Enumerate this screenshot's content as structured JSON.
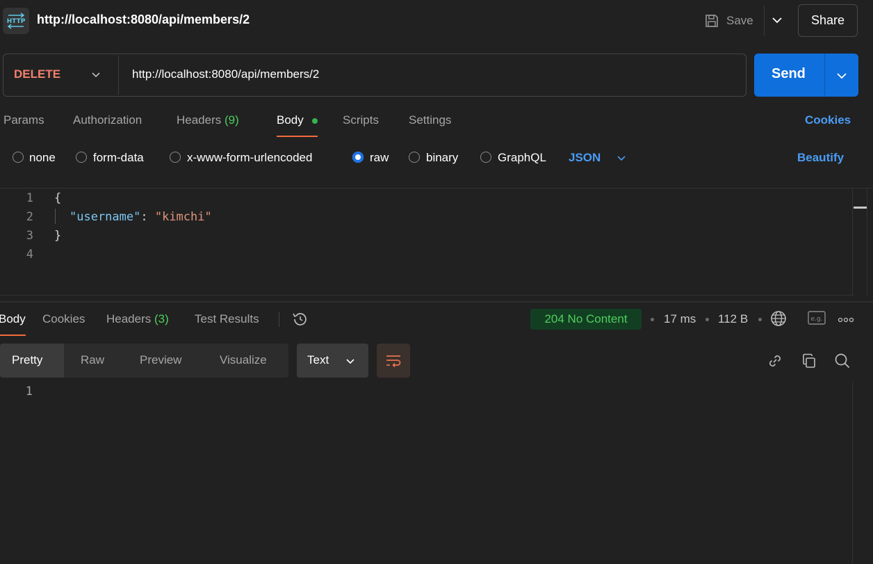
{
  "header": {
    "title": "http://localhost:8080/api/members/2",
    "app_icon_label": "HTTP",
    "save_label": "Save",
    "share_label": "Share"
  },
  "request": {
    "method": "DELETE",
    "url": "http://localhost:8080/api/members/2",
    "send_label": "Send",
    "tabs": [
      {
        "label": "Params"
      },
      {
        "label": "Authorization"
      },
      {
        "label": "Headers",
        "count": "(9)"
      },
      {
        "label": "Body"
      },
      {
        "label": "Scripts"
      },
      {
        "label": "Settings"
      }
    ],
    "cookies_label": "Cookies",
    "body_types": [
      "none",
      "form-data",
      "x-www-form-urlencoded",
      "raw",
      "binary",
      "GraphQL"
    ],
    "selected_body_type": "raw",
    "format": "JSON",
    "beautify_label": "Beautify",
    "editor_lines": [
      "1",
      "2",
      "3",
      "4"
    ],
    "code": {
      "open_brace": "{",
      "key": "\"username\"",
      "colon": ": ",
      "value": "\"kimchi\"",
      "close_brace": "}"
    }
  },
  "response": {
    "tabs": [
      {
        "label": "Body"
      },
      {
        "label": "Cookies"
      },
      {
        "label": "Headers",
        "count": "(3)"
      },
      {
        "label": "Test Results"
      }
    ],
    "status": "204 No Content",
    "time": "17 ms",
    "size": "112 B",
    "view_modes": [
      "Pretty",
      "Raw",
      "Preview",
      "Visualize"
    ],
    "format": "Text",
    "lines": [
      "1"
    ]
  },
  "colors": {
    "accent": "#f26b3a",
    "send": "#0f6fdc",
    "method": "#f2806d",
    "link": "#4a9cf5",
    "status_ok": "#4fce5d"
  }
}
